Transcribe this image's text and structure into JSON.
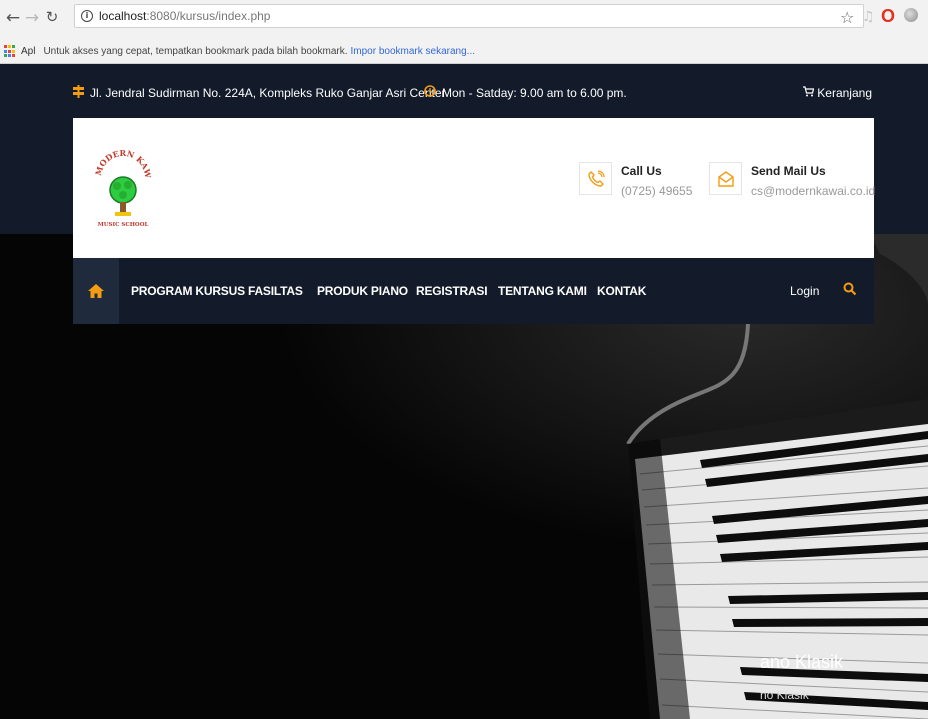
{
  "browser": {
    "url_host": "localhost",
    "url_rest": ":8080/kursus/index.php",
    "bookmarks_apps": "Apl",
    "bookmarks_hint": "Untuk akses yang cepat, tempatkan bookmark pada bilah bookmark.",
    "bookmarks_import": "Impor bookmark sekarang..."
  },
  "topbar": {
    "address": "Jl. Jendral Sudirman No. 224A, Kompleks Ruko Ganjar Asri Center",
    "hours": "Mon - Satday: 9.00 am to 6.00 pm.",
    "cart": "Keranjang"
  },
  "header": {
    "logo_text_top": "MODERN KAWAI",
    "logo_text_bottom": "MUSIC SCHOOL",
    "call_title": "Call Us",
    "call_value": "(0725) 49655",
    "mail_title": "Send Mail Us",
    "mail_value": "cs@modernkawai.co.id"
  },
  "nav": {
    "items": [
      "PROGRAM KURSUS",
      "FASILTAS",
      "PRODUK PIANO",
      "REGISTRASI",
      "TENTANG KAMI",
      "KONTAK"
    ],
    "login": "Login"
  },
  "slide": {
    "title": "ano Klasik",
    "subtitle": "no Klasik"
  },
  "colors": {
    "accent": "#f39c12",
    "navy": "#131b2a"
  }
}
